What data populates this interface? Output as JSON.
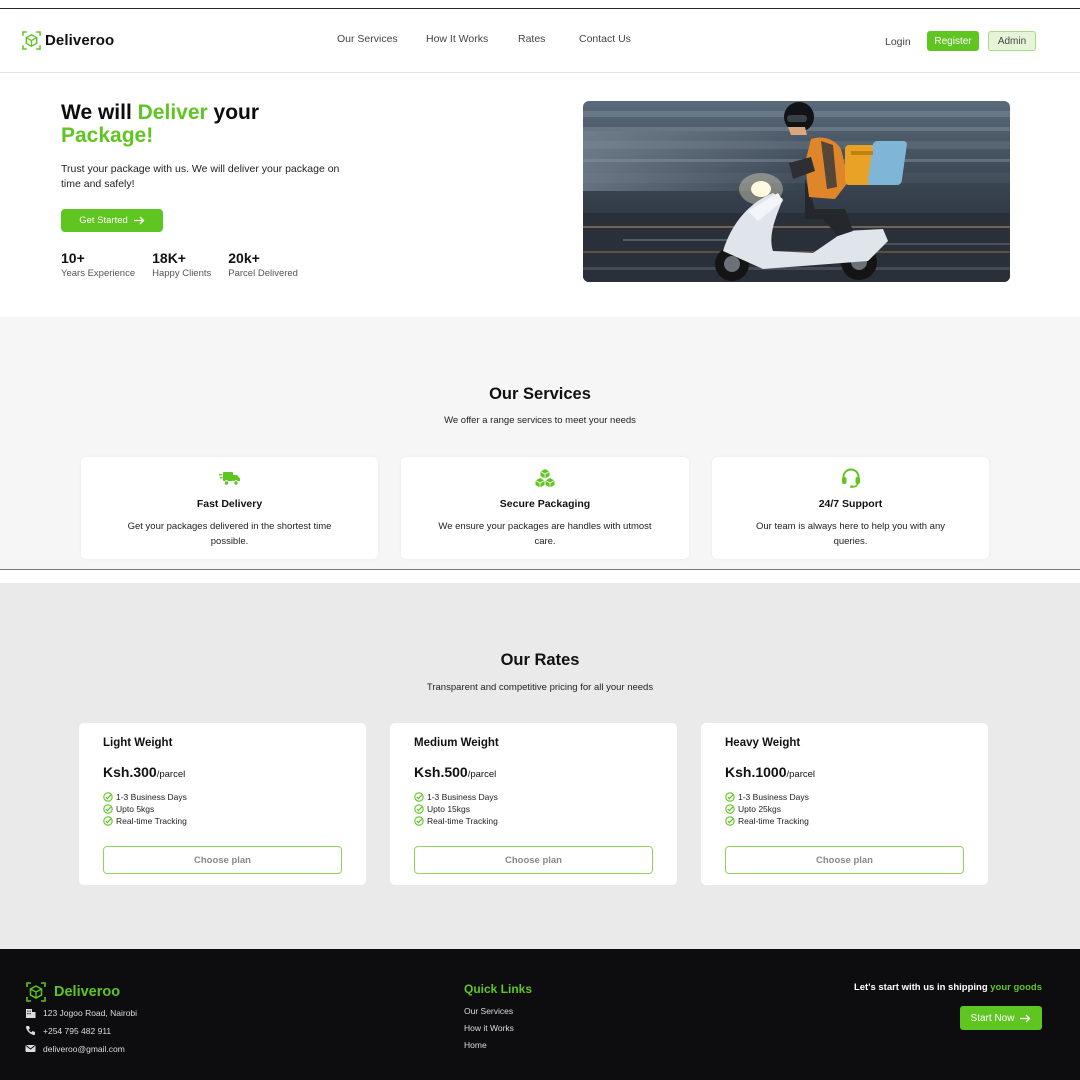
{
  "brand": {
    "name": "Deliveroo",
    "accent": "#5fc521",
    "dark": "#0d0d0f"
  },
  "nav": {
    "links": [
      "Our Services",
      "How It Works",
      "Rates",
      "Contact Us"
    ],
    "login": "Login",
    "register": "Register",
    "admin": "Admin"
  },
  "hero": {
    "title_part1": "We will ",
    "title_highlight": "Deliver",
    "title_part2": " your",
    "title_line2": "Package!",
    "description": "Trust your package with us. We will deliver your package on time and safely!",
    "cta": "Get Started",
    "stats": [
      {
        "value": "10+",
        "label": "Years Experience"
      },
      {
        "value": "18K+",
        "label": "Happy Clients"
      },
      {
        "value": "20k+",
        "label": "Parcel Delivered"
      }
    ]
  },
  "services": {
    "title": "Our Services",
    "subtitle": "We offer a range services to meet your needs",
    "items": [
      {
        "icon": "truck-icon",
        "title": "Fast Delivery",
        "description": "Get your packages delivered in the shortest time possible."
      },
      {
        "icon": "boxes-icon",
        "title": "Secure Packaging",
        "description": "We ensure your packages are handles with utmost care."
      },
      {
        "icon": "headset-icon",
        "title": "24/7 Support",
        "description": "Our team is always here to help you with any queries."
      }
    ]
  },
  "rates": {
    "title": "Our Rates",
    "subtitle": "Transparent and competitive pricing for all your needs",
    "plans": [
      {
        "name": "Light Weight",
        "price": "Ksh.300",
        "per": "/parcel",
        "features": [
          "1-3 Business Days",
          "Upto 5kgs",
          "Real-time Tracking"
        ],
        "cta": "Choose plan"
      },
      {
        "name": "Medium Weight",
        "price": "Ksh.500",
        "per": "/parcel",
        "features": [
          "1-3 Business Days",
          "Upto 15kgs",
          "Real-time Tracking"
        ],
        "cta": "Choose plan"
      },
      {
        "name": "Heavy Weight",
        "price": "Ksh.1000",
        "per": "/parcel",
        "features": [
          "1-3 Business Days",
          "Upto 25kgs",
          "Real-time Tracking"
        ],
        "cta": "Choose plan"
      }
    ]
  },
  "footer": {
    "address": "123 Jogoo Road, Nairobi",
    "phone": "+254 795 482 911",
    "email": "deliveroo@gmail.com",
    "quick_links_title": "Quick Links",
    "quick_links": [
      "Our Services",
      "How it Works",
      "Home"
    ],
    "cta_text": "Let's start with us in shipping ",
    "cta_highlight": "your goods",
    "cta_button": "Start Now"
  }
}
